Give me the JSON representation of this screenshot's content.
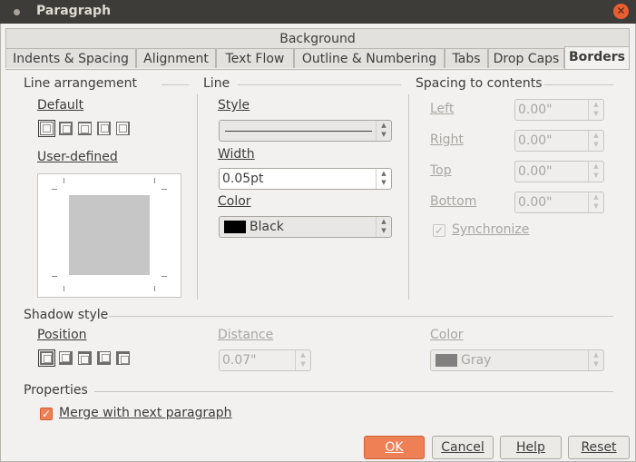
{
  "window": {
    "title": "Paragraph"
  },
  "tabs": {
    "top_row": [
      "Background"
    ],
    "bottom_row": [
      "Indents & Spacing",
      "Alignment",
      "Text Flow",
      "Outline & Numbering",
      "Tabs",
      "Drop Caps",
      "Borders"
    ],
    "active": "Borders"
  },
  "line_arrangement": {
    "header": "Line arrangement",
    "default_label": "Default",
    "user_defined_label": "User-defined"
  },
  "line": {
    "header": "Line",
    "style_label": "Style",
    "width_label": "Width",
    "width_value": "0.05pt",
    "color_label": "Color",
    "color_value": "Black",
    "color_swatch": "#000000"
  },
  "spacing": {
    "header": "Spacing to contents",
    "left_label": "Left",
    "left_value": "0.00\"",
    "right_label": "Right",
    "right_value": "0.00\"",
    "top_label": "Top",
    "top_value": "0.00\"",
    "bottom_label": "Bottom",
    "bottom_value": "0.00\"",
    "synchronize_label": "Synchronize",
    "synchronize_checked": true
  },
  "shadow": {
    "header": "Shadow style",
    "position_label": "Position",
    "distance_label": "Distance",
    "distance_value": "0.07\"",
    "color_label": "Color",
    "color_value": "Gray",
    "color_swatch": "#808080"
  },
  "properties": {
    "header": "Properties",
    "merge_label": "Merge with next paragraph",
    "merge_checked": true
  },
  "buttons": {
    "ok": "OK",
    "cancel": "Cancel",
    "help": "Help",
    "reset": "Reset"
  },
  "colors": {
    "accent": "#ef7f55",
    "titlebar": "#3d3c38",
    "close": "#ea5e2f"
  }
}
